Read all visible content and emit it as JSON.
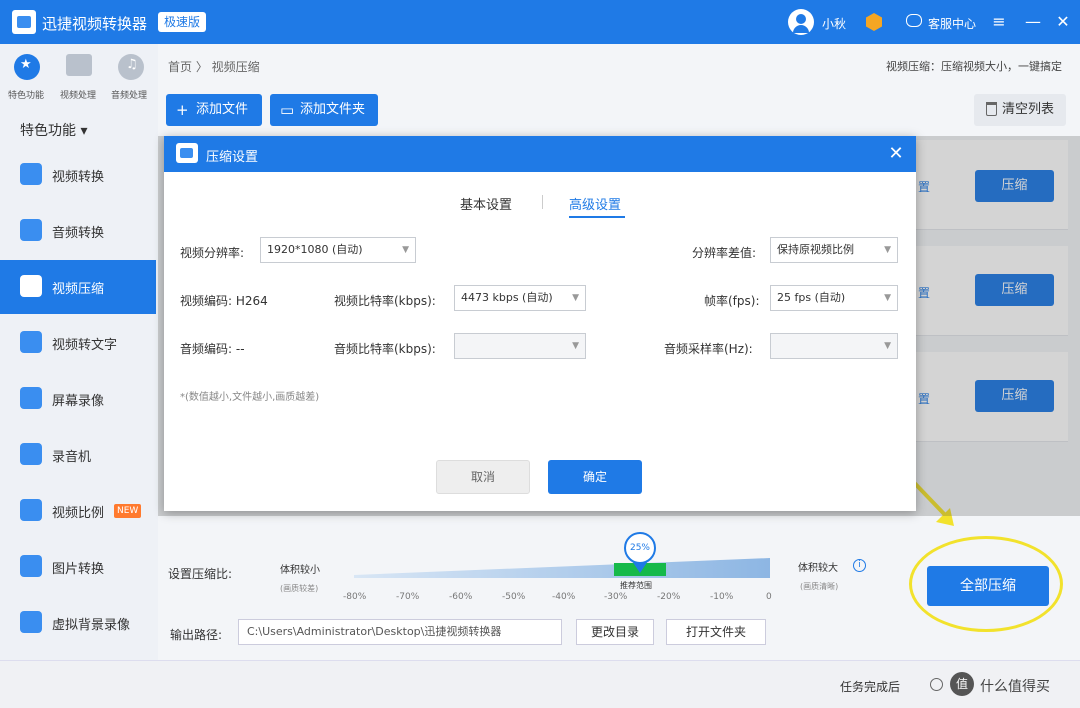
{
  "window": {
    "app_title": "迅捷视频转换器",
    "edition": "极速版",
    "user": "小秋",
    "help_center": "客服中心",
    "controls": [
      "≡",
      "—",
      "✕"
    ]
  },
  "top_modes": [
    "特色功能",
    "视频处理",
    "音频处理"
  ],
  "sidebar": {
    "dropdown": "特色功能 ▾",
    "items": [
      {
        "label": "视频转换"
      },
      {
        "label": "音频转换"
      },
      {
        "label": "视频压缩"
      },
      {
        "label": "视频转文字"
      },
      {
        "label": "屏幕录像"
      },
      {
        "label": "录音机"
      },
      {
        "label": "视频比例"
      },
      {
        "label": "图片转换"
      },
      {
        "label": "虚拟背景录像"
      }
    ],
    "new_badge": "NEW"
  },
  "main": {
    "breadcrumb": "首页 〉 视频压缩",
    "hint": "视频压缩：压缩视频大小，一键搞定",
    "toolbar": {
      "add_file": "添加文件",
      "add_folder": "添加文件夹",
      "clear_list": "清空列表"
    },
    "row_button": "压缩",
    "row_edge": "置"
  },
  "dialog": {
    "title": "压缩设置",
    "close": "✕",
    "tabs": {
      "basic": "基本设置",
      "advanced": "高级设置"
    },
    "fields": {
      "resolution_label": "视频分辨率:",
      "resolution_value": "1920*1080 (自动)",
      "res_diff_label": "分辨率差值:",
      "res_diff_value": "保持原视频比例",
      "video_codec_label": "视频编码: H264",
      "video_bitrate_label": "视频比特率(kbps):",
      "video_bitrate_value": "4473 kbps (自动)",
      "fps_label": "帧率(fps):",
      "fps_value": "25 fps (自动)",
      "audio_codec_label": "音频编码: --",
      "audio_bitrate_label": "音频比特率(kbps):",
      "audio_bitrate_value": "",
      "sample_rate_label": "音频采样率(Hz):",
      "sample_rate_value": ""
    },
    "note": "*(数值越小,文件越小,画质越差)",
    "cancel": "取消",
    "ok": "确定"
  },
  "compress": {
    "ratio_label": "设置压缩比:",
    "small_label": "体积较小",
    "small_sub": "(画质较差)",
    "big_label": "体积较大",
    "big_sub": "(画质清晰)",
    "info_icon": "i",
    "value_pct": 25,
    "value_label": "25%",
    "zone_label": "推荐范围",
    "ticks": [
      "-80%",
      "-70%",
      "-60%",
      "-50%",
      "-40%",
      "-30%",
      "-20%",
      "-10%",
      "0"
    ],
    "out_label": "输出路径:",
    "out_path": "C:\\Users\\Administrator\\Desktop\\迅捷视频转换器",
    "change_dir": "更改目录",
    "open_folder": "打开文件夹",
    "compress_all": "全部压缩"
  },
  "status": {
    "after_task": "任务完成后",
    "watermark_badge": "值",
    "watermark_text": "什么值得买"
  },
  "colors": {
    "accent": "#1f7ae6",
    "highlight": "#f2e22c",
    "recommend": "#16b94a",
    "new_badge": "#ff7a2e"
  }
}
